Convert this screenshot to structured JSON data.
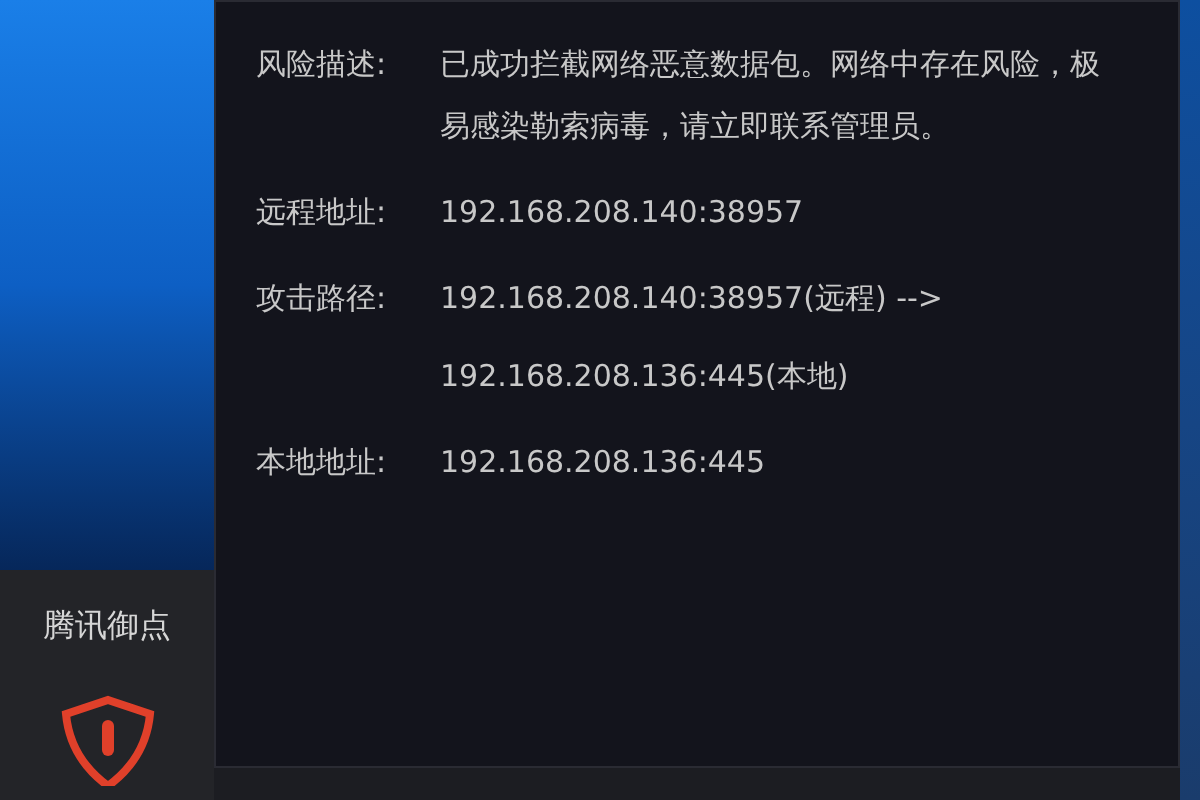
{
  "sidebar": {
    "title": "腾讯御点"
  },
  "details": [
    {
      "label": "风险描述:",
      "value": "已成功拦截网络恶意数据包。网络中存在风险，极易感染勒索病毒，请立即联系管理员。"
    },
    {
      "label": "远程地址:",
      "value": "192.168.208.140:38957"
    },
    {
      "label": "攻击路径:",
      "value": "192.168.208.140:38957(远程) -->",
      "continuation": "192.168.208.136:445(本地)"
    },
    {
      "label": "本地地址:",
      "value": "192.168.208.136:445"
    }
  ]
}
